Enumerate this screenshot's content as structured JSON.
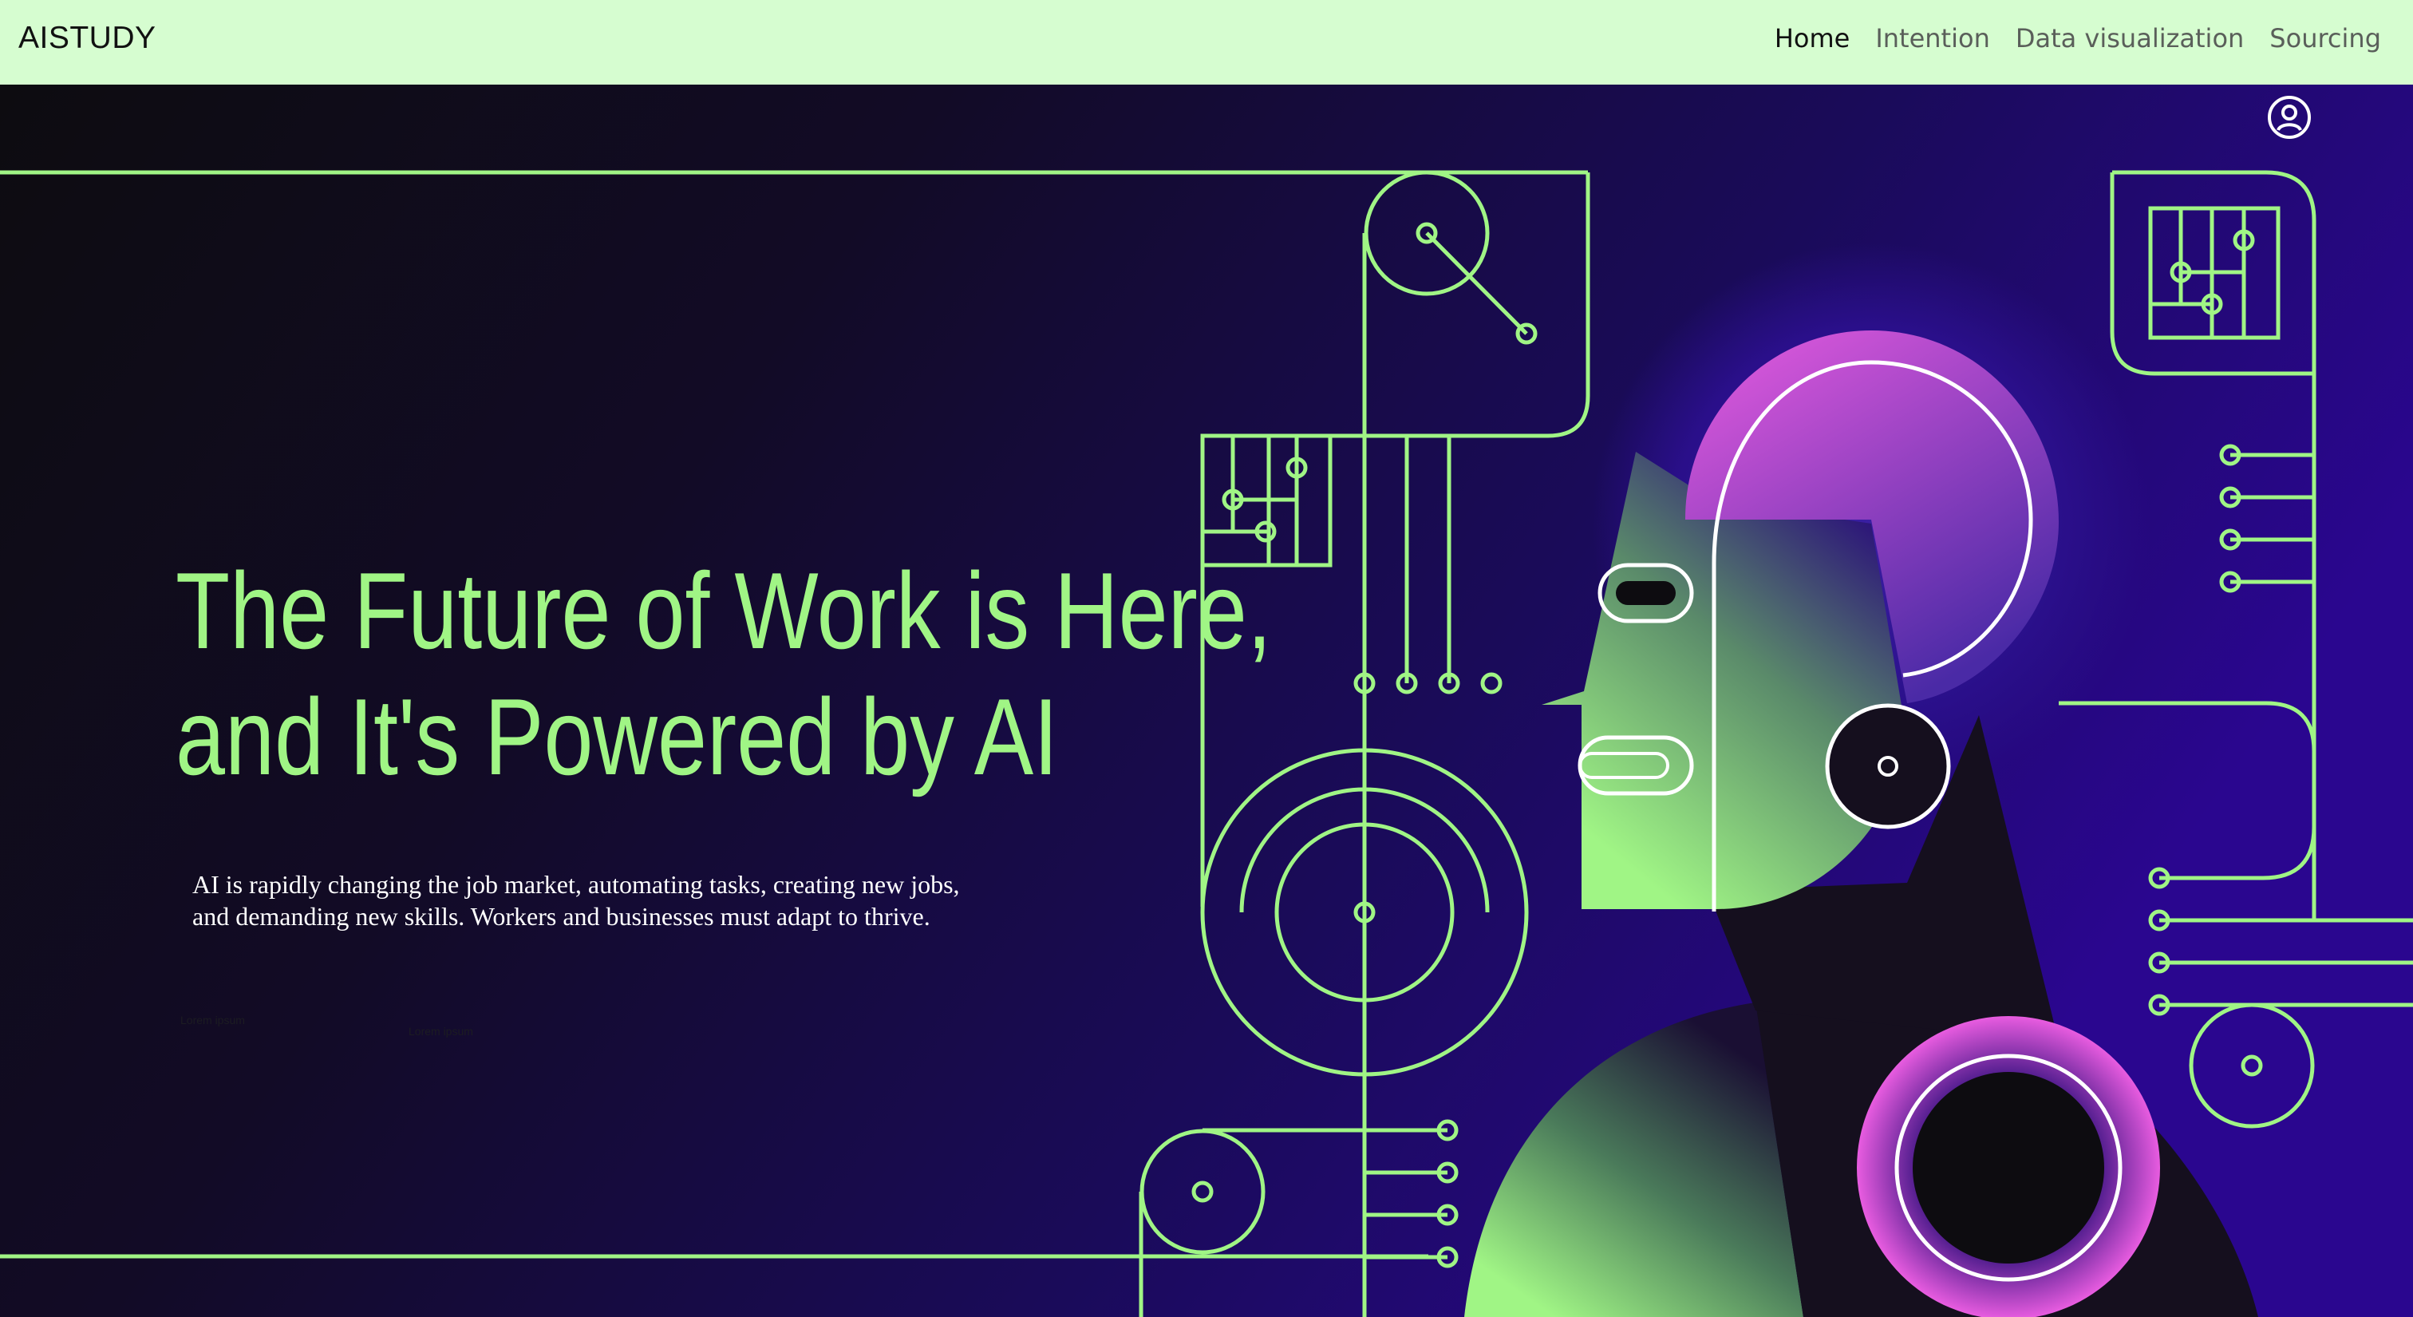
{
  "brand": "AISTUDY",
  "nav": [
    {
      "label": "Home",
      "active": true
    },
    {
      "label": "Intention",
      "active": false
    },
    {
      "label": "Data visualization",
      "active": false
    },
    {
      "label": "Sourcing",
      "active": false
    }
  ],
  "user_icon": "user-circle-icon",
  "hero": {
    "headline_line1": "The Future of Work is Here,",
    "headline_line2": "and It's Powered by AI",
    "subtext_line1": "AI is rapidly changing the job market, automating tasks, creating new jobs,",
    "subtext_line2": "and demanding new skills. Workers and businesses must adapt to thrive.",
    "tiny_label_1": "Lorem ipsum",
    "tiny_label_2": "Lorem ipsum"
  },
  "colors": {
    "navbar_bg": "#d6fdd0",
    "accent_green": "#a0f585",
    "accent_magenta": "#e85ce0",
    "deep_purple": "#2a068f",
    "dark_bg": "#0d0c10"
  }
}
